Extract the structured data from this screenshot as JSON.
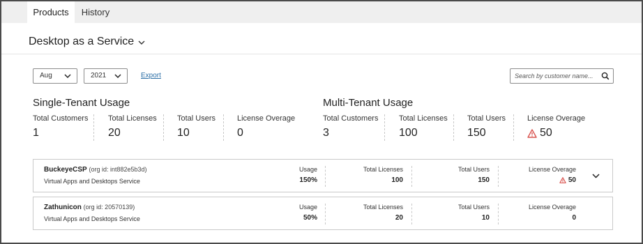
{
  "tabs": [
    {
      "label": "Products",
      "active": true
    },
    {
      "label": "History",
      "active": false
    }
  ],
  "service": {
    "title": "Desktop as a Service"
  },
  "filters": {
    "month": "Aug",
    "year": "2021",
    "export_label": "Export",
    "search_placeholder": "Search by customer name..."
  },
  "single_tenant": {
    "title": "Single-Tenant Usage",
    "stats": [
      {
        "label": "Total Customers",
        "value": "1"
      },
      {
        "label": "Total Licenses",
        "value": "20"
      },
      {
        "label": "Total Users",
        "value": "10"
      },
      {
        "label": "License Overage",
        "value": "0"
      }
    ]
  },
  "multi_tenant": {
    "title": "Multi-Tenant Usage",
    "stats": [
      {
        "label": "Total Customers",
        "value": "3"
      },
      {
        "label": "Total Licenses",
        "value": "100"
      },
      {
        "label": "Total Users",
        "value": "150"
      },
      {
        "label": "License Overage",
        "value": "50",
        "warning": true
      }
    ]
  },
  "customers": [
    {
      "name": "BuckeyeCSP",
      "org_id": "(org id: int882e5b3d)",
      "service": "Virtual Apps and Desktops Service",
      "usage_label": "Usage",
      "usage": "150%",
      "licenses_label": "Total Licenses",
      "licenses": "100",
      "users_label": "Total Users",
      "users": "150",
      "overage_label": "License Overage",
      "overage": "50",
      "warning": true
    },
    {
      "name": "Zathunicon",
      "org_id": "(org id: 20570139)",
      "service": "Virtual Apps and Desktops Service",
      "usage_label": "Usage",
      "usage": "50%",
      "licenses_label": "Total Licenses",
      "licenses": "20",
      "users_label": "Total Users",
      "users": "10",
      "overage_label": "License Overage",
      "overage": "0",
      "warning": false
    }
  ],
  "colors": {
    "warning": "#d9534f",
    "link": "#2a6ea6"
  },
  "icons": {
    "dropdown": "chevron-down-icon",
    "search": "search-icon",
    "warning": "warning-triangle-icon",
    "expand": "chevron-down-icon"
  }
}
